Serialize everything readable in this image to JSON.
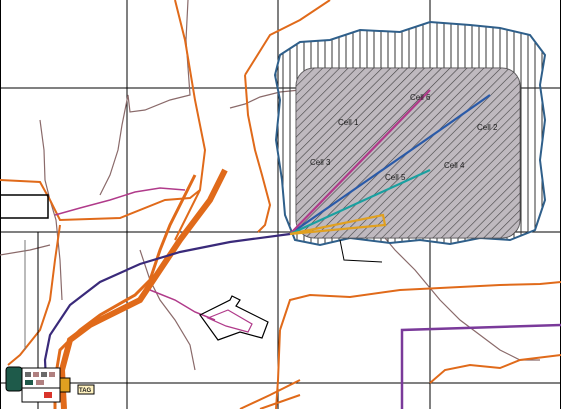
{
  "map": {
    "cell_labels": [
      "Cell 1",
      "Cell 2",
      "Cell 3",
      "Cell 4",
      "Cell 5",
      "Cell 6"
    ],
    "corner_tag": "TAG",
    "colors": {
      "grid": "#000000",
      "road": "#e06a1a",
      "main_road": "#e06a1a",
      "trail": "#8a6a6a",
      "pipe_purple": "#3a2a7a",
      "pipe_pink": "#b03a8a",
      "pipe_blue": "#2a5aa8",
      "pipe_teal": "#1aa0a0",
      "pipe_gold": "#e0a020",
      "pad_outline": "#2f5f8a",
      "boundary_purple": "#7a3a9a"
    }
  }
}
